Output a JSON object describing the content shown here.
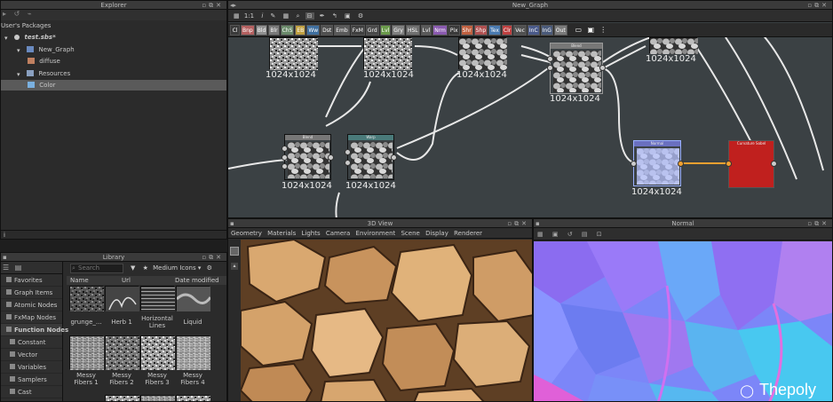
{
  "explorer": {
    "title": "Explorer",
    "header": "User's Packages",
    "tree": [
      {
        "label": "test.sbs*",
        "indent": 4
      },
      {
        "label": "New_Graph",
        "indent": 18
      },
      {
        "label": "diffuse",
        "indent": 30
      },
      {
        "label": "Resources",
        "indent": 18
      },
      {
        "label": "Color",
        "indent": 30
      }
    ]
  },
  "graph": {
    "title": "New_Graph",
    "toolbar_zoom": "1:1",
    "chips": [
      {
        "label": "Cl",
        "color": "#3a3a3a"
      },
      {
        "label": "Bnp",
        "color": "#b46060"
      },
      {
        "label": "Bld",
        "color": "#909090"
      },
      {
        "label": "Blr",
        "color": "#7a7a7a"
      },
      {
        "label": "ChS",
        "color": "#6a8a6a"
      },
      {
        "label": "EB",
        "color": "#c0a040"
      },
      {
        "label": "Ww",
        "color": "#3f6f9f"
      },
      {
        "label": "Dst",
        "color": "#505050"
      },
      {
        "label": "Emb",
        "color": "#5a5a5a"
      },
      {
        "label": "FxM",
        "color": "#404040"
      },
      {
        "label": "Grd",
        "color": "#4a4a4a"
      },
      {
        "label": "Lvl",
        "color": "#6a9a4a"
      },
      {
        "label": "Gry",
        "color": "#808080"
      },
      {
        "label": "HSL",
        "color": "#707070"
      },
      {
        "label": "Lvl",
        "color": "#5a5a5a"
      },
      {
        "label": "Nrm",
        "color": "#8a5ab0"
      },
      {
        "label": "Pix",
        "color": "#3a3a3a"
      },
      {
        "label": "Shr",
        "color": "#c06040"
      },
      {
        "label": "Shp",
        "color": "#b05050"
      },
      {
        "label": "Tex",
        "color": "#4a7ab0"
      },
      {
        "label": "Clr",
        "color": "#c04040"
      },
      {
        "label": "Vec",
        "color": "#505050"
      },
      {
        "label": "InC",
        "color": "#4a5a8a"
      },
      {
        "label": "InG",
        "color": "#4a5a7a"
      },
      {
        "label": "Out",
        "color": "#7a7a7a"
      }
    ],
    "nodes": [
      {
        "res": "1024x1024",
        "header": ""
      },
      {
        "res": "1024x1024",
        "header": ""
      },
      {
        "res": "1024x1024",
        "header": ""
      },
      {
        "res": "1024x1024",
        "header": "Blend"
      },
      {
        "res": "1024x1024",
        "header": ""
      },
      {
        "res": "1024x1024",
        "header": "Blend"
      },
      {
        "res": "1024x1024",
        "header": "Warp"
      },
      {
        "res": "1024x1024",
        "header": "Normal"
      },
      {
        "res": "",
        "header": "Curvature Sobel"
      }
    ]
  },
  "view3d": {
    "title": "3D View",
    "menu": [
      "Geometry",
      "Materials",
      "Lights",
      "Camera",
      "Environment",
      "Scene",
      "Display",
      "Renderer"
    ]
  },
  "normal_view": {
    "title": "Normal"
  },
  "library": {
    "title": "Library",
    "search_placeholder": "Search",
    "filter_label": "Medium Icons",
    "columns": {
      "name": "Name",
      "url": "Url",
      "date": "Date modified"
    },
    "categories": [
      {
        "label": "Favorites",
        "header": false
      },
      {
        "label": "Graph Items",
        "header": false
      },
      {
        "label": "Atomic Nodes",
        "header": false
      },
      {
        "label": "FxMap Nodes",
        "header": false
      },
      {
        "label": "Function Nodes",
        "header": true
      },
      {
        "label": "Constant",
        "header": false
      },
      {
        "label": "Vector",
        "header": false
      },
      {
        "label": "Variables",
        "header": false
      },
      {
        "label": "Samplers",
        "header": false
      },
      {
        "label": "Cast",
        "header": false
      }
    ],
    "items": [
      {
        "label": "grunge_..."
      },
      {
        "label": "Herb 1"
      },
      {
        "label": "Horizontal Lines"
      },
      {
        "label": "Liquid"
      },
      {
        "label": "Messy Fibers 1"
      },
      {
        "label": "Messy Fibers 2"
      },
      {
        "label": "Messy Fibers 3"
      },
      {
        "label": "Messy Fibers 4"
      }
    ]
  },
  "watermark": "Thepoly",
  "colors": {
    "graph_bg": "#3b4144",
    "panel_bg": "#2b2b2b",
    "selection": "#5a5a5a",
    "output_red": "#c0201e",
    "link_orange": "#f0a030"
  }
}
